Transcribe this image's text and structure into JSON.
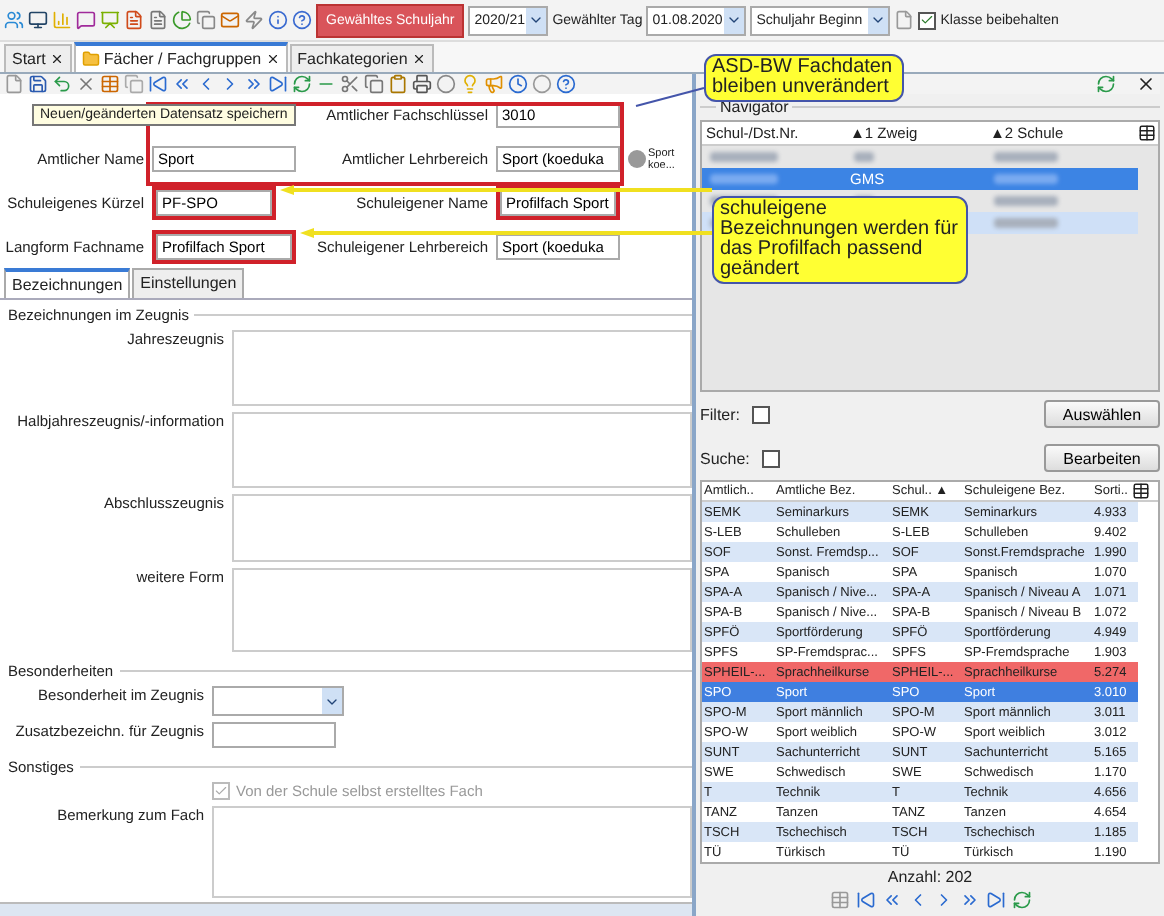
{
  "top_bar": {
    "schoolyear_button": "Gewähltes Schuljahr",
    "schoolyear": "2020/21",
    "day_label": "Gewählter Tag",
    "day": "01.08.2020",
    "period": "Schuljahr Beginn",
    "keep_class": {
      "label": "Klasse beibehalten",
      "checked": true
    }
  },
  "tabs": [
    {
      "label": "Start",
      "selected": false
    },
    {
      "label": "Fächer / Fachgruppen",
      "selected": true
    },
    {
      "label": "Fachkategorien",
      "selected": false
    }
  ],
  "tooltip": "Neuen/geänderten Datensatz speichern",
  "form": {
    "official_key": {
      "label": "Amtlicher Fachschlüssel",
      "value": "3010"
    },
    "official_name": {
      "label": "Amtlicher Name",
      "value": "Sport"
    },
    "official_area": {
      "label": "Amtlicher Lehrbereich",
      "value": "Sport (koeduka",
      "note": "Sport koe..."
    },
    "short": {
      "label": "Schuleigenes Kürzel",
      "value": "PF-SPO"
    },
    "school_name": {
      "label": "Schuleigener Name",
      "value": "Profilfach Sport"
    },
    "long_name": {
      "label": "Langform Fachname",
      "value": "Profilfach Sport"
    },
    "school_area": {
      "label": "Schuleigener Lehrbereich",
      "value": "Sport (koeduka"
    }
  },
  "detail_tabs": [
    {
      "label": "Bezeichnungen",
      "selected": true
    },
    {
      "label": "Einstellungen",
      "selected": false
    }
  ],
  "certificate": {
    "title": "Bezeichnungen im Zeugnis",
    "fields": [
      "Jahreszeugnis",
      "Halbjahreszeugnis/-information",
      "Abschlusszeugnis",
      "weitere Form"
    ]
  },
  "special": {
    "title": "Besonderheiten",
    "dropdown": "Besonderheit im Zeugnis",
    "extra": "Zusatzbezeichn. für Zeugnis"
  },
  "other": {
    "title": "Sonstiges",
    "checkbox": {
      "label": "Von der Schule selbst erstelltes Fach",
      "checked": true,
      "disabled": true
    },
    "remark": "Bemerkung zum Fach"
  },
  "callouts": [
    "ASD-BW Fachdaten bleiben unverändert",
    "schuleigene Bezeichnungen werden für das Profilfach passend geändert"
  ],
  "navigator": {
    "title": "Navigator",
    "columns": [
      "Schul-/Dst.Nr.",
      "▲1 Zweig",
      "▲2 Schule"
    ],
    "rows": [
      {
        "branch": null,
        "selected": false
      },
      {
        "branch": "GMS",
        "selected": true
      },
      {
        "branch": null,
        "selected": false
      },
      {
        "branch": null,
        "selected": false
      }
    ],
    "filter": {
      "label": "Filter:",
      "checked": false
    },
    "search": {
      "label": "Suche:",
      "checked": false
    },
    "select_button": "Auswählen",
    "edit_button": "Bearbeiten"
  },
  "subjects": {
    "columns": [
      "Amtlich..",
      "Amtliche Bez.",
      "Schul.. ▲",
      "Schuleigene Bez.",
      "Sorti.."
    ],
    "rows": [
      {
        "cells": [
          "SEMK",
          "Seminarkurs",
          "SEMK",
          "Seminarkurs",
          "4.933"
        ],
        "selected": false,
        "marked": false
      },
      {
        "cells": [
          "S-LEB",
          "Schulleben",
          "S-LEB",
          "Schulleben",
          "9.402"
        ],
        "selected": false,
        "marked": false
      },
      {
        "cells": [
          "SOF",
          "Sonst. Fremdsp...",
          "SOF",
          "Sonst.Fremdsprache",
          "1.990"
        ],
        "selected": false,
        "marked": false
      },
      {
        "cells": [
          "SPA",
          "Spanisch",
          "SPA",
          "Spanisch",
          "1.070"
        ],
        "selected": false,
        "marked": false
      },
      {
        "cells": [
          "SPA-A",
          "Spanisch / Nive...",
          "SPA-A",
          "Spanisch / Niveau A",
          "1.071"
        ],
        "selected": false,
        "marked": false
      },
      {
        "cells": [
          "SPA-B",
          "Spanisch / Nive...",
          "SPA-B",
          "Spanisch / Niveau B",
          "1.072"
        ],
        "selected": false,
        "marked": false
      },
      {
        "cells": [
          "SPFÖ",
          "Sportförderung",
          "SPFÖ",
          "Sportförderung",
          "4.949"
        ],
        "selected": false,
        "marked": false
      },
      {
        "cells": [
          "SPFS",
          "SP-Fremdsprac...",
          "SPFS",
          "SP-Fremdsprache",
          "1.903"
        ],
        "selected": false,
        "marked": false
      },
      {
        "cells": [
          "SPHEIL-...",
          "Sprachheilkurse",
          "SPHEIL-...",
          "Sprachheilkurse",
          "5.274"
        ],
        "selected": false,
        "marked": true
      },
      {
        "cells": [
          "SPO",
          "Sport",
          "SPO",
          "Sport",
          "3.010"
        ],
        "selected": true,
        "marked": false
      },
      {
        "cells": [
          "SPO-M",
          "Sport männlich",
          "SPO-M",
          "Sport männlich",
          "3.011"
        ],
        "selected": false,
        "marked": false
      },
      {
        "cells": [
          "SPO-W",
          "Sport weiblich",
          "SPO-W",
          "Sport weiblich",
          "3.012"
        ],
        "selected": false,
        "marked": false
      },
      {
        "cells": [
          "SUNT",
          "Sachunterricht",
          "SUNT",
          "Sachunterricht",
          "5.165"
        ],
        "selected": false,
        "marked": false
      },
      {
        "cells": [
          "SWE",
          "Schwedisch",
          "SWE",
          "Schwedisch",
          "1.170"
        ],
        "selected": false,
        "marked": false
      },
      {
        "cells": [
          "T",
          "Technik",
          "T",
          "Technik",
          "4.656"
        ],
        "selected": false,
        "marked": false
      },
      {
        "cells": [
          "TANZ",
          "Tanzen",
          "TANZ",
          "Tanzen",
          "4.654"
        ],
        "selected": false,
        "marked": false
      },
      {
        "cells": [
          "TSCH",
          "Tschechisch",
          "TSCH",
          "Tschechisch",
          "1.185"
        ],
        "selected": false,
        "marked": false
      },
      {
        "cells": [
          "TÜ",
          "Türkisch",
          "TÜ",
          "Türkisch",
          "1.190"
        ],
        "selected": false,
        "marked": false
      }
    ],
    "count": "Anzahl: 202"
  }
}
